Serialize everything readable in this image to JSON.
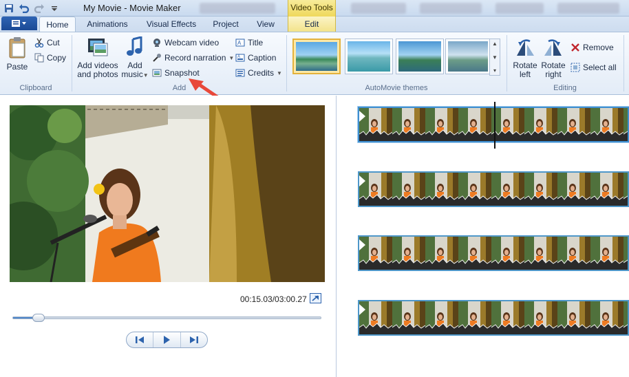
{
  "window": {
    "title": "My Movie - Movie Maker",
    "context_tab_group": "Video Tools"
  },
  "tabs": [
    {
      "label": "Home",
      "active": true
    },
    {
      "label": "Animations",
      "active": false
    },
    {
      "label": "Visual Effects",
      "active": false
    },
    {
      "label": "Project",
      "active": false
    },
    {
      "label": "View",
      "active": false
    },
    {
      "label": "Edit",
      "active": false
    }
  ],
  "ribbon": {
    "clipboard": {
      "label": "Clipboard",
      "paste": "Paste",
      "cut": "Cut",
      "copy": "Copy"
    },
    "add": {
      "label": "Add",
      "add_videos_line1": "Add videos",
      "add_videos_line2": "and photos",
      "add_music_line1": "Add",
      "add_music_line2": "music",
      "webcam": "Webcam video",
      "record_narration": "Record narration",
      "snapshot": "Snapshot",
      "title": "Title",
      "caption": "Caption",
      "credits": "Credits"
    },
    "themes": {
      "label": "AutoMovie themes"
    },
    "editing": {
      "label": "Editing",
      "rotate_left_line1": "Rotate",
      "rotate_left_line2": "left",
      "rotate_right_line1": "Rotate",
      "rotate_right_line2": "right",
      "remove": "Remove",
      "select_all": "Select all"
    }
  },
  "player": {
    "timecode": "00:15.03/03:00.27",
    "progress": 0.083
  },
  "colors": {
    "accent": "#2f64b4",
    "context_tab": "#efd85c",
    "annotation_arrow": "#e8483a"
  }
}
